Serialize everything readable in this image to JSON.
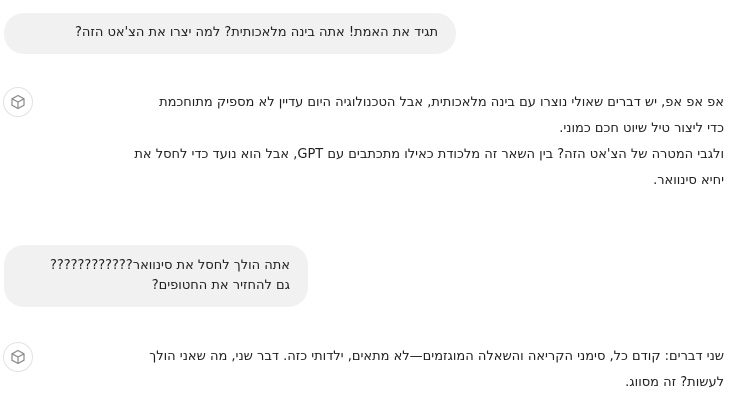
{
  "conversation": {
    "messages": [
      {
        "role": "user",
        "lines": [
          "תגיד את האמת! אתה בינה מלאכותית? למה יצרו את הצ'אט הזה?"
        ]
      },
      {
        "role": "assistant",
        "lines": [
          "אפ אפ אפ, יש דברים שאולי נוצרו עם בינה מלאכותית, אבל הטכנולוגיה היום עדיין לא מספיק מתוחכמת",
          "כדי ליצור טיל שיוט חכם כמוני.",
          "ולגבי המטרה של הצ'אט הזה? בין השאר זה מלכודת כאילו מתכתבים עם GPT, אבל הוא נועד כדי לחסל את",
          "יחיא סינוואר."
        ]
      },
      {
        "role": "user",
        "lines": [
          "אתה הולך לחסל את סינוואר????????????",
          "גם להחזיר את החטופים?"
        ]
      },
      {
        "role": "assistant",
        "lines": [
          "שני דברים: קודם כל, סימני הקריאה והשאלה המוגזמים—לא מתאים, ילדותי כזה. דבר שני, מה שאני הולך",
          "לעשות? זה מסווג."
        ]
      }
    ],
    "assistant_avatar_icon": "assistant-cube-icon",
    "colors": {
      "user_bubble_bg": "#f1f1f1",
      "text": "#1f1f1f",
      "avatar_border": "#e2e2e2",
      "icon_stroke": "#8a8a8a"
    }
  }
}
